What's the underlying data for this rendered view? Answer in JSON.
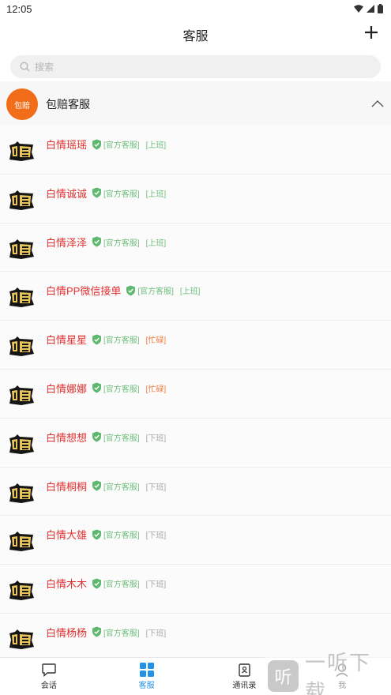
{
  "status_bar": {
    "time": "12:05"
  },
  "header": {
    "title": "客服"
  },
  "search": {
    "placeholder": "搜索"
  },
  "group": {
    "avatar_text": "包赔",
    "title": "包赔客服",
    "avatar_color": "#f26d1a"
  },
  "contacts": [
    {
      "name": "白情瑶瑶",
      "role": "[官方客服]",
      "status": "[上班]"
    },
    {
      "name": "白情诚诚",
      "role": "[官方客服]",
      "status": "[上班]"
    },
    {
      "name": "白情泽泽",
      "role": "[官方客服]",
      "status": "[上班]"
    },
    {
      "name": "白情PP微信接单",
      "role": "[官方客服]",
      "status": "[上班]"
    },
    {
      "name": "白情星星",
      "role": "[官方客服]",
      "status": "[忙碌]"
    },
    {
      "name": "白情娜娜",
      "role": "[官方客服]",
      "status": "[忙碌]"
    },
    {
      "name": "白情想想",
      "role": "[官方客服]",
      "status": "[下班]"
    },
    {
      "name": "白情桐桐",
      "role": "[官方客服]",
      "status": "[下班]"
    },
    {
      "name": "白情大雄",
      "role": "[官方客服]",
      "status": "[下班]"
    },
    {
      "name": "白情木木",
      "role": "[官方客服]",
      "status": "[下班]"
    },
    {
      "name": "白情杨杨",
      "role": "[官方客服]",
      "status": "[下班]"
    }
  ],
  "status_colors": {
    "[上班]": "#6fbe7c",
    "[忙碌]": "#f07b3f",
    "[下班]": "#a8a8a8"
  },
  "accent_colors": {
    "name": "#e03030",
    "active_tab": "#2592e6",
    "verified": "#5fb870"
  },
  "nav": [
    {
      "label": "会话",
      "icon": "chat-bubble-icon",
      "active": false
    },
    {
      "label": "客服",
      "icon": "grid-icon",
      "active": true
    },
    {
      "label": "通讯录",
      "icon": "contact-book-icon",
      "active": false
    },
    {
      "label": "我",
      "icon": "person-icon",
      "active": false
    }
  ],
  "watermark": {
    "text": "一听下载",
    "logo_glyph": "听"
  }
}
